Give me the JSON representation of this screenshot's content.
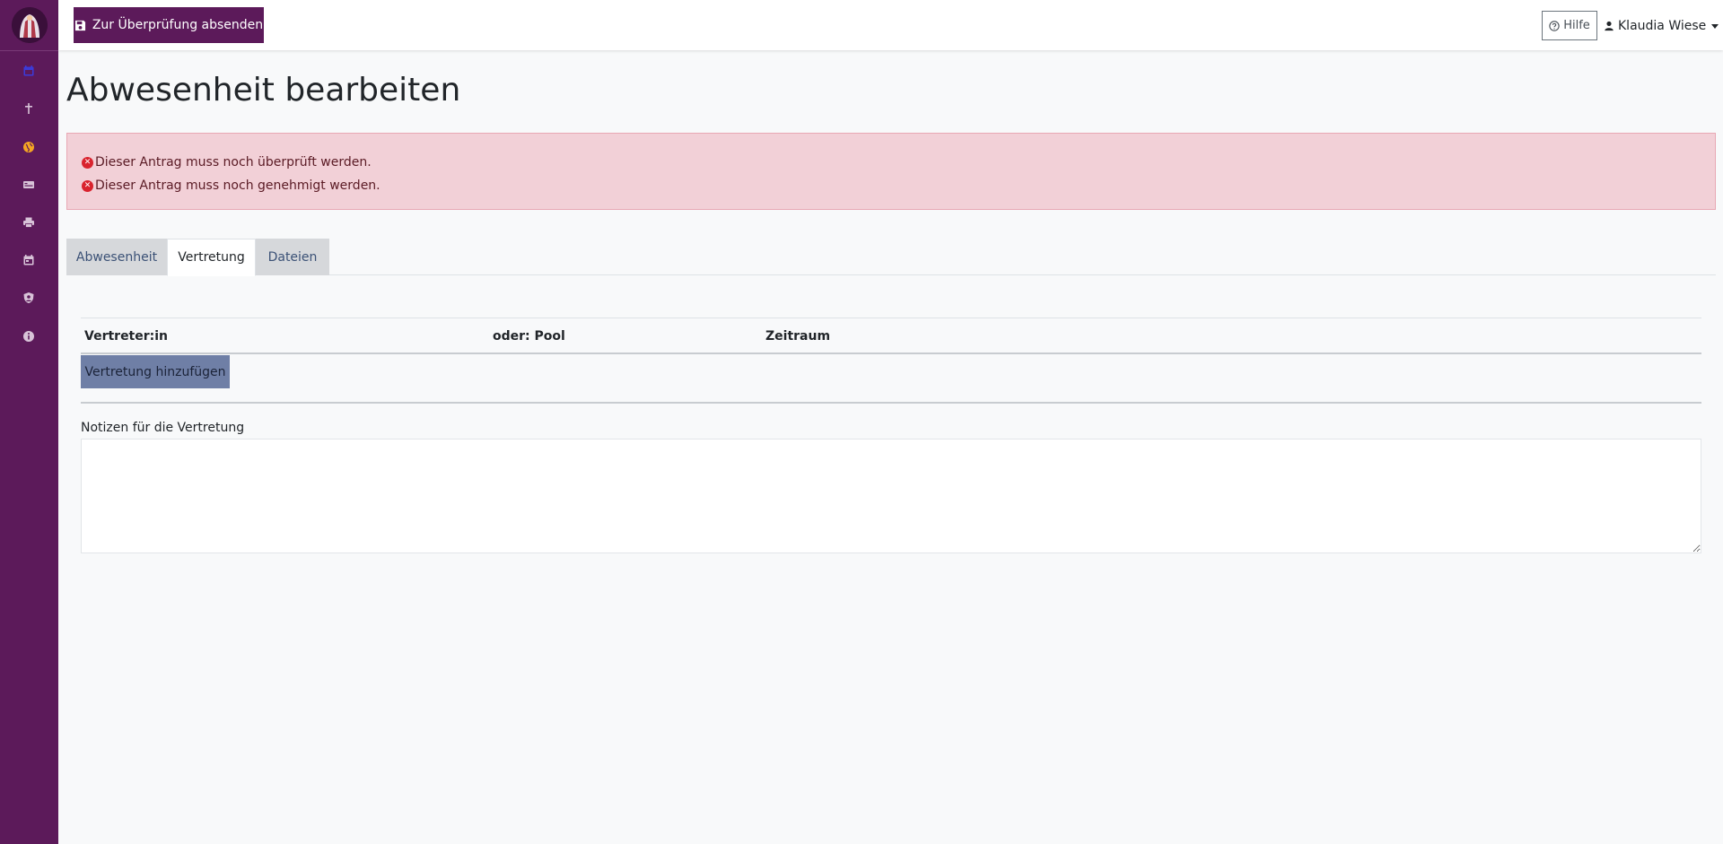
{
  "topbar": {
    "submit_label": "Zur Überprüfung absenden",
    "help_label": "Hilfe",
    "user_name": "Klaudia Wiese"
  },
  "sidebar": {
    "items": [
      {
        "icon": "calendar-icon",
        "color": "#3b3bd9"
      },
      {
        "icon": "cross-icon",
        "color": "#d8c3d8"
      },
      {
        "icon": "globe-icon",
        "color": "#f5a623"
      },
      {
        "icon": "id-card-icon",
        "color": "#d8c3d8"
      },
      {
        "icon": "printer-icon",
        "color": "#d8c3d8"
      },
      {
        "icon": "calendar-week-icon",
        "color": "#d8c3d8"
      },
      {
        "icon": "user-shield-icon",
        "color": "#d8c3d8"
      },
      {
        "icon": "info-icon",
        "color": "#d8c3d8"
      }
    ]
  },
  "page": {
    "title": "Abwesenheit bearbeiten"
  },
  "alerts": [
    "Dieser Antrag muss noch überprüft werden.",
    "Dieser Antrag muss noch genehmigt werden."
  ],
  "tabs": [
    {
      "label": "Abwesenheit",
      "active": false
    },
    {
      "label": "Vertretung",
      "active": true
    },
    {
      "label": "Dateien",
      "active": false
    }
  ],
  "table": {
    "columns": [
      "Vertreter:in",
      "oder: Pool",
      "Zeitraum"
    ],
    "add_label": "Vertretung hinzufügen"
  },
  "notes": {
    "label": "Notizen für die Vertretung",
    "value": ""
  },
  "colors": {
    "brand": "#5c1a5a",
    "alert_bg": "#f2d0d7",
    "add_button": "#6f7fa6"
  }
}
